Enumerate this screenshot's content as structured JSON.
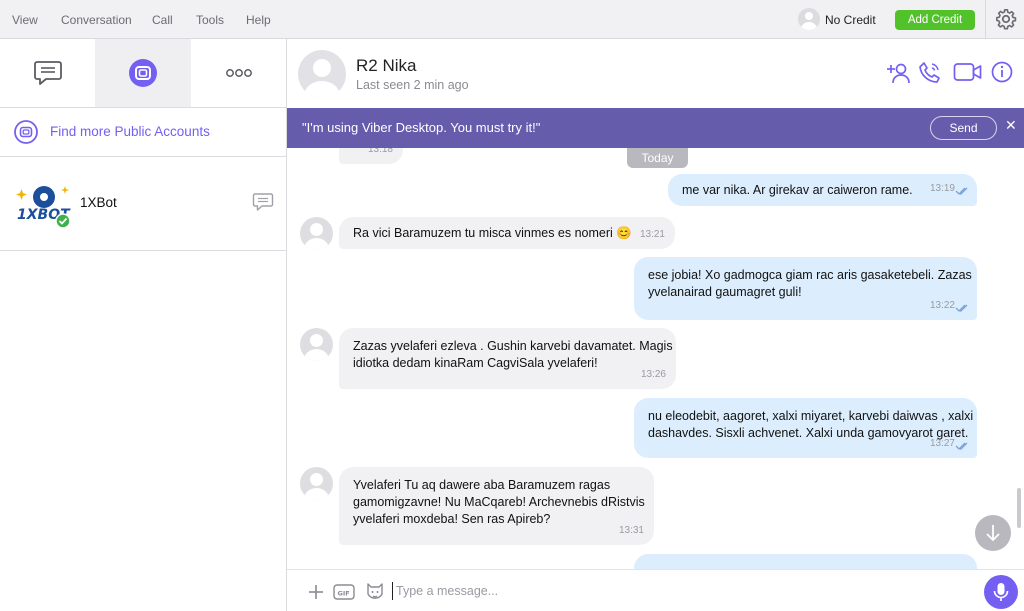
{
  "menu": {
    "items": [
      "View",
      "Conversation",
      "Call",
      "Tools",
      "Help"
    ],
    "credit_status": "No Credit",
    "add_credit_label": "Add Credit"
  },
  "sidebar": {
    "tabs": [
      {
        "icon": "chat-bubble-icon",
        "active": false
      },
      {
        "icon": "public-accounts-icon",
        "active": true
      },
      {
        "icon": "more-dots-icon",
        "active": false
      }
    ],
    "find_more_label": "Find more Public Accounts",
    "contacts": [
      {
        "name": "1XBot",
        "logo_text": "1XBOT",
        "verified": true,
        "icon": "chat-bubble-icon"
      }
    ]
  },
  "chat": {
    "name": "R2 Nika",
    "last_seen": "Last seen 2 min ago",
    "banner_text": "\"I'm using Viber Desktop. You must try it!\"",
    "banner_send_label": "Send",
    "today_label": "Today",
    "messages": [
      {
        "dir": "in",
        "lines": [
          ""
        ],
        "time": "13:18"
      },
      {
        "dir": "out",
        "lines": [
          "me var nika. Ar girekav ar caiweron rame."
        ],
        "time": "13:19",
        "delivered": true
      },
      {
        "dir": "in",
        "lines": [
          "Ra vici Baramuzem tu misca vinmes es nomeri 😊"
        ],
        "time": "13:21"
      },
      {
        "dir": "out",
        "lines": [
          "ese jobia! Xo gadmogca giam rac aris gasaketebeli. Zazas",
          "yvelanairad gaumagret guli!"
        ],
        "time": "13:22",
        "delivered": true
      },
      {
        "dir": "in",
        "lines": [
          "Zazas yvelaferi ezleva . Gushin karvebi davamatet. Magis",
          "idiotka dedam kinaRam CagviSala yvelaferi!"
        ],
        "time": "13:26"
      },
      {
        "dir": "out",
        "lines": [
          "nu eleodebit, aagoret, xalxi miyaret, karvebi daiwvas , xalxi",
          "dashavdes. Sisxli achvenet. Xalxi unda gamovyarot garet."
        ],
        "time": "13:27",
        "delivered": true
      },
      {
        "dir": "in",
        "lines": [
          "Yvelaferi Tu aq dawere aba Baramuzem ragas",
          "gamomigzavne! Nu MaCqareb! Archevnebis dRistvis",
          "yvelaferi moxdeba!  Sen ras Apireb?"
        ],
        "time": "13:31"
      },
      {
        "dir": "out",
        "lines": [
          ""
        ],
        "time": ""
      }
    ]
  },
  "composer": {
    "placeholder": "Type a message..."
  },
  "colors": {
    "viber_purple": "#7360f2",
    "banner_bg": "#665cac",
    "add_credit_green": "#52c22b",
    "incoming_bubble": "#f1f1f3",
    "outgoing_bubble": "#dceefd"
  }
}
